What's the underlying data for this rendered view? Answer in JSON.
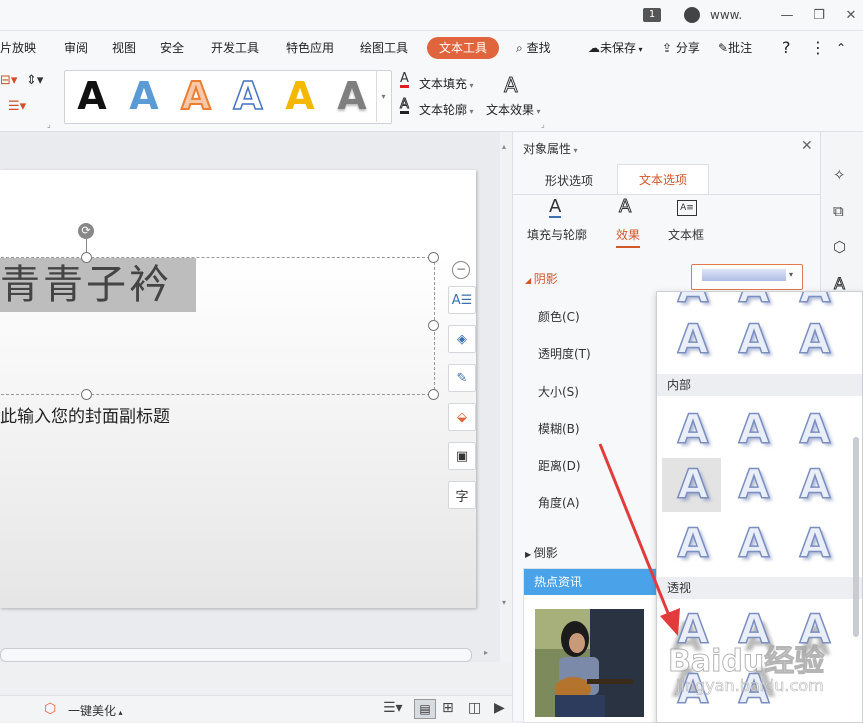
{
  "titlebar": {
    "badge": "1",
    "account": "www."
  },
  "menu": {
    "items": [
      "幻灯片放映",
      "审阅",
      "视图",
      "安全",
      "开发工具",
      "特色应用",
      "绘图工具",
      "文本工具"
    ],
    "first_visible": "片放映",
    "search": "查找",
    "unsaved": "未保存",
    "share": "分享",
    "comment": "批注",
    "help": "?",
    "more": "⋮"
  },
  "ribbon": {
    "text_fill": "文本填充",
    "text_outline": "文本轮廓",
    "text_effect": "文本效果",
    "gallery_styles": [
      {
        "glyph": "A",
        "color": "#111111",
        "style": "solid"
      },
      {
        "glyph": "A",
        "color": "#5b9bd5",
        "style": "solid"
      },
      {
        "glyph": "A",
        "color": "#ed7d31",
        "style": "outline"
      },
      {
        "glyph": "A",
        "color": "#4472c4",
        "style": "outline"
      },
      {
        "glyph": "A",
        "color": "#f5b800",
        "style": "solid"
      },
      {
        "glyph": "A",
        "color": "#7f7f7f",
        "style": "gradient"
      }
    ]
  },
  "slide": {
    "title_text": "青青子衿",
    "subtitle_text": "此输入您的封面副标题"
  },
  "panel": {
    "title": "对象属性",
    "tabs": [
      "形状选项",
      "文本选项"
    ],
    "active_tab": "文本选项",
    "subtabs": [
      "填充与轮廓",
      "效果",
      "文本框"
    ],
    "active_subtab": "效果",
    "section_shadow": "阴影",
    "props": [
      "颜色(C)",
      "透明度(T)",
      "大小(S)",
      "模糊(B)",
      "距离(D)",
      "角度(A)"
    ],
    "section_reflection": "倒影"
  },
  "dropdown": {
    "section_inner": "内部",
    "section_perspective": "透视",
    "glyph": "A"
  },
  "news": {
    "header": "热点资讯"
  },
  "statusbar": {
    "beautify": "一键美化"
  },
  "watermark": {
    "text": "Baidu经验",
    "url": "jingyan.baidu.com"
  },
  "colors": {
    "accent": "#e0653c",
    "active_tab": "#d4572a",
    "news_header": "#4aa3e8",
    "arrow": "#e23b3b"
  }
}
